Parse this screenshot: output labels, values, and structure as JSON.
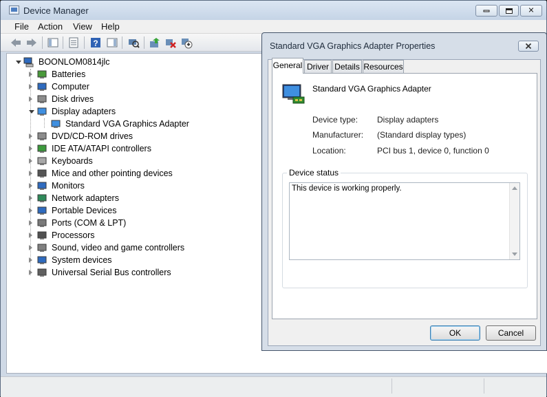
{
  "window": {
    "title": "Device Manager"
  },
  "menu": [
    "File",
    "Action",
    "View",
    "Help"
  ],
  "toolbar": {
    "buttons": [
      "back-arrow-icon",
      "forward-arrow-icon",
      "show-hide-tree-icon",
      "properties-icon",
      "help-icon",
      "action-pane-icon",
      "scan-hardware-icon",
      "update-driver-icon",
      "uninstall-icon",
      "disable-device-icon"
    ]
  },
  "tree": {
    "root": "BOONLOM0814jlc",
    "items": [
      {
        "label": "Batteries",
        "icon": "battery-icon",
        "expanded": false
      },
      {
        "label": "Computer",
        "icon": "computer-icon",
        "expanded": false
      },
      {
        "label": "Disk drives",
        "icon": "disk-drive-icon",
        "expanded": false
      },
      {
        "label": "Display adapters",
        "icon": "display-adapter-icon",
        "expanded": true
      },
      {
        "label": "Standard VGA Graphics Adapter",
        "icon": "display-adapter-icon",
        "child": true
      },
      {
        "label": "DVD/CD-ROM drives",
        "icon": "dvd-drive-icon",
        "expanded": false
      },
      {
        "label": "IDE ATA/ATAPI controllers",
        "icon": "ide-controller-icon",
        "expanded": false
      },
      {
        "label": "Keyboards",
        "icon": "keyboard-icon",
        "expanded": false
      },
      {
        "label": "Mice and other pointing devices",
        "icon": "mouse-icon",
        "expanded": false
      },
      {
        "label": "Monitors",
        "icon": "monitor-icon",
        "expanded": false
      },
      {
        "label": "Network adapters",
        "icon": "network-adapter-icon",
        "expanded": false
      },
      {
        "label": "Portable Devices",
        "icon": "portable-device-icon",
        "expanded": false
      },
      {
        "label": "Ports (COM & LPT)",
        "icon": "port-icon",
        "expanded": false
      },
      {
        "label": "Processors",
        "icon": "processor-icon",
        "expanded": false
      },
      {
        "label": "Sound, video and game controllers",
        "icon": "sound-icon",
        "expanded": false
      },
      {
        "label": "System devices",
        "icon": "system-device-icon",
        "expanded": false
      },
      {
        "label": "Universal Serial Bus controllers",
        "icon": "usb-icon",
        "expanded": false
      }
    ]
  },
  "dialog": {
    "title": "Standard VGA Graphics Adapter Properties",
    "tabs": [
      "General",
      "Driver",
      "Details",
      "Resources"
    ],
    "active_tab": "General",
    "device_name": "Standard VGA Graphics Adapter",
    "props": {
      "device_type_label": "Device type:",
      "device_type_value": "Display adapters",
      "manufacturer_label": "Manufacturer:",
      "manufacturer_value": "(Standard display types)",
      "location_label": "Location:",
      "location_value": "PCI bus 1, device 0, function 0"
    },
    "status_group_label": "Device status",
    "status_text": "This device is working properly.",
    "ok_label": "OK",
    "cancel_label": "Cancel"
  },
  "colors": {
    "titlebar": "#c5d4e6",
    "accent": "#4d7ec0"
  }
}
